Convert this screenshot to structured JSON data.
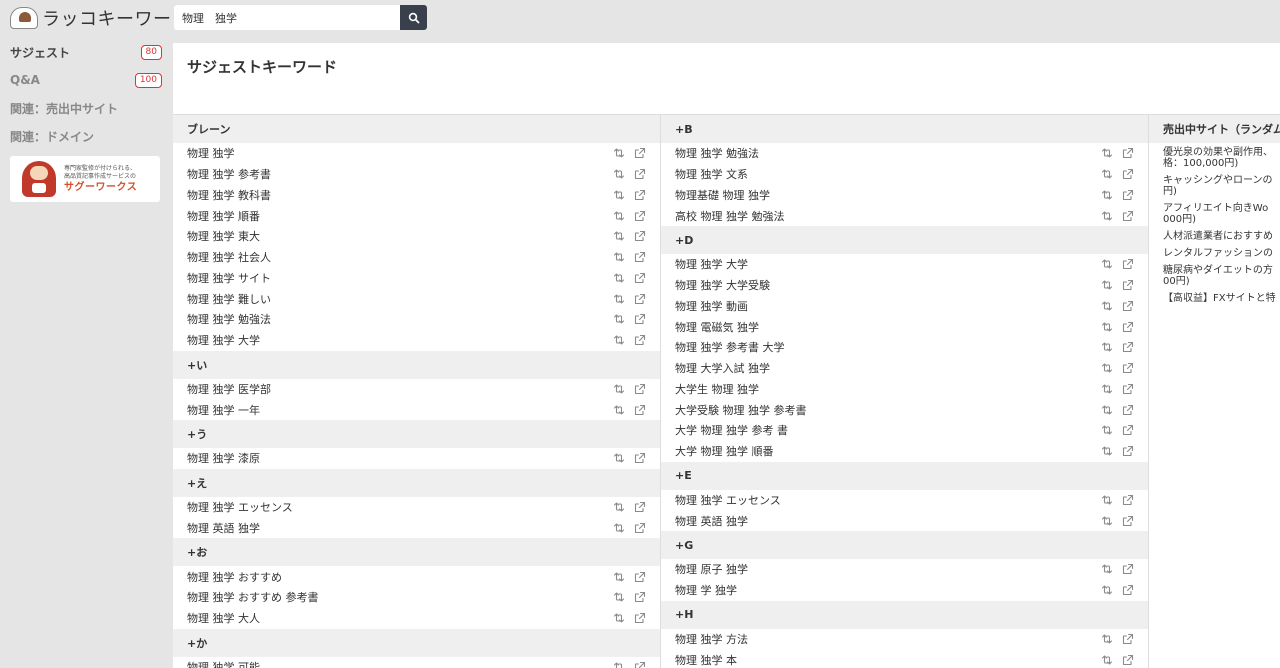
{
  "header": {
    "logo_text": "ラッコキーワード",
    "search_value": "物理　独学",
    "search_icon": "search-icon"
  },
  "sidebar": {
    "items": [
      {
        "label": "サジェスト",
        "badge": "80"
      },
      {
        "label": "Q&A",
        "badge": "100"
      },
      {
        "label": "関連：売出中サイト",
        "badge": ""
      },
      {
        "label": "関連：ドメイン",
        "badge": ""
      }
    ],
    "ad": {
      "line1": "専門家監修が付けられる、",
      "line2": "高品質記事作成サービスの",
      "brand": "サグーワークス"
    }
  },
  "main": {
    "title": "サジェストキーワード"
  },
  "columns": [
    [
      {
        "head": "ブレーン",
        "items": [
          "物理 独学",
          "物理 独学 参考書",
          "物理 独学 教科書",
          "物理 独学 順番",
          "物理 独学 東大",
          "物理 独学 社会人",
          "物理 独学 サイト",
          "物理 独学 難しい",
          "物理 独学 勉強法",
          "物理 独学 大学"
        ]
      },
      {
        "head": "+い",
        "items": [
          "物理 独学 医学部",
          "物理 独学 一年"
        ]
      },
      {
        "head": "+う",
        "items": [
          "物理 独学 漆原"
        ]
      },
      {
        "head": "+え",
        "items": [
          "物理 独学 エッセンス",
          "物理 英語 独学"
        ]
      },
      {
        "head": "+お",
        "items": [
          "物理 独学 おすすめ",
          "物理 独学 おすすめ 参考書",
          "物理 独学 大人"
        ]
      },
      {
        "head": "+か",
        "items": [
          "物理 独学 可能"
        ]
      }
    ],
    [
      {
        "head": "+B",
        "items": [
          "物理 独学 勉強法",
          "物理 独学 文系",
          "物理基礎 物理 独学",
          "高校 物理 独学 勉強法"
        ]
      },
      {
        "head": "+D",
        "items": [
          "物理 独学 大学",
          "物理 独学 大学受験",
          "物理 独学 動画",
          "物理 電磁気 独学",
          "物理 独学 参考書 大学",
          "物理 大学入試 独学",
          "大学生 物理 独学",
          "大学受験 物理 独学 参考書",
          "大学 物理 独学 参考 書",
          "大学 物理 独学 順番"
        ]
      },
      {
        "head": "+E",
        "items": [
          "物理 独学 エッセンス",
          "物理 英語 独学"
        ]
      },
      {
        "head": "+G",
        "items": [
          "物理 原子 独学",
          "物理 学 独学"
        ]
      },
      {
        "head": "+H",
        "items": [
          "物理 独学 方法",
          "物理 独学 本"
        ]
      }
    ]
  ],
  "sites": {
    "head": "売出中サイト（ランダム",
    "items": [
      [
        "優光泉の効果や副作用、",
        "格：100,000円)"
      ],
      [
        "キャッシングやローンの",
        "円)"
      ],
      [
        "アフィリエイト向きWo",
        "000円)"
      ],
      [
        "人材派遣業者におすすめ"
      ],
      [
        "レンタルファッションの"
      ],
      [
        "糖尿病やダイエットの方",
        "00円)"
      ],
      [
        "【高収益】FXサイトと特"
      ]
    ]
  }
}
